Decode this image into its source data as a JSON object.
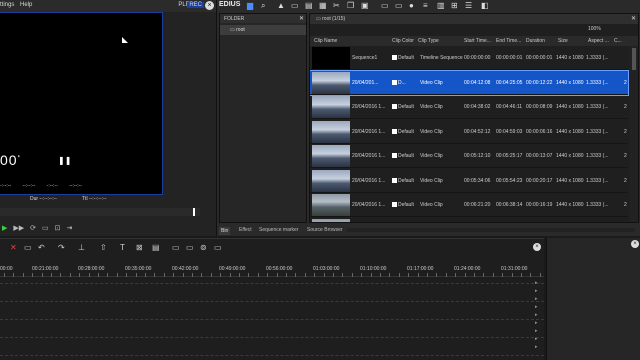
{
  "player": {
    "menu_items": [
      "ttings",
      "Help"
    ],
    "plr_label": "PLR",
    "rec_label": "REC",
    "timecode": "00",
    "timecode_suffix": "*",
    "dash_fields": [
      "-:--:--",
      "--:--:--",
      "-:--:--",
      "--:--:--"
    ],
    "dur_label": "Dur --:--:--:--",
    "ttl_label": "Ttl --:--:--:--"
  },
  "bin": {
    "title": "EDIUS",
    "folder_header": "FOLDER",
    "root_folder": "root",
    "path": "root (1/15)",
    "zoom": "100%",
    "columns": [
      "Clip Name",
      "Clip Color",
      "Clip Type",
      "Start Time...",
      "End Time...",
      "Duration",
      "Size",
      "Aspect ...",
      "C..."
    ],
    "rows": [
      {
        "name": "Sequence1",
        "color": "Default",
        "type": "Timeline Sequence",
        "start": "00:00:00:00",
        "end": "00:00:00:01",
        "duration": "00:00:00:01",
        "size": "1440 x 1080",
        "aspect": "1.3333 (...",
        "c": "",
        "thumb": "black"
      },
      {
        "name": "20/04/201...",
        "color": "D...",
        "type": "Video Clip",
        "start": "00:04:12:08",
        "end": "00:04:25:05",
        "duration": "00:00:12:22",
        "size": "1440 x 1080",
        "aspect": "1.3333 (...",
        "c": "2",
        "thumb": "snow",
        "selected": true
      },
      {
        "name": "20/04/2016 1...",
        "color": "Default",
        "type": "Video Clip",
        "start": "00:04:38:02",
        "end": "00:04:46:11",
        "duration": "00:00:08:09",
        "size": "1440 x 1080",
        "aspect": "1.3333 (...",
        "c": "2",
        "thumb": "snow"
      },
      {
        "name": "20/04/2016 1...",
        "color": "Default",
        "type": "Video Clip",
        "start": "00:04:52:12",
        "end": "00:04:59:03",
        "duration": "00:00:06:16",
        "size": "1440 x 1080",
        "aspect": "1.3333 (...",
        "c": "2",
        "thumb": "snow"
      },
      {
        "name": "20/04/2016 1...",
        "color": "Default",
        "type": "Video Clip",
        "start": "00:05:12:10",
        "end": "00:05:25:17",
        "duration": "00:00:13:07",
        "size": "1440 x 1080",
        "aspect": "1.3333 (...",
        "c": "2",
        "thumb": "snow"
      },
      {
        "name": "20/04/2016 1...",
        "color": "Default",
        "type": "Video Clip",
        "start": "00:05:34:06",
        "end": "00:05:54:23",
        "duration": "00:00:20:17",
        "size": "1440 x 1080",
        "aspect": "1.3333 (...",
        "c": "2",
        "thumb": "snow"
      },
      {
        "name": "20/04/2016 1...",
        "color": "Default",
        "type": "Video Clip",
        "start": "00:06:21:20",
        "end": "00:06:38:14",
        "duration": "00:00:16:19",
        "size": "1440 x 1080",
        "aspect": "1.3333 (...",
        "c": "2",
        "thumb": "road"
      },
      {
        "name": "20/04/2016 1...",
        "color": "Default",
        "type": "Video Clip",
        "start": "00:06:54:06",
        "end": "00:07:02:22",
        "duration": "00:00:08:16",
        "size": "1440 x 1080",
        "aspect": "1.3333 (...",
        "c": "2",
        "thumb": "road"
      }
    ],
    "tabs": [
      "Bin",
      "Effect",
      "Sequence marker",
      "Source Browser"
    ]
  },
  "timeline": {
    "ruler": [
      "00:00",
      "00:21:00:00",
      "00:28:00:00",
      "00:35:00:00",
      "00:42:00:00",
      "00:49:00:00",
      "00:56:00:00",
      "01:03:00:00",
      "01:10:00:00",
      "01:17:00:00",
      "01:24:00:00",
      "01:31:00:00"
    ]
  }
}
